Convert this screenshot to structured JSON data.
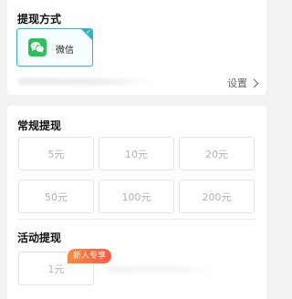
{
  "withdraw_method": {
    "title": "提现方式",
    "option_label": "微信",
    "option_icon": "wechat-icon",
    "settings_label": "设置"
  },
  "regular_withdraw": {
    "title": "常规提现",
    "amounts": [
      "5元",
      "10元",
      "20元",
      "50元",
      "100元",
      "200元"
    ]
  },
  "activity_withdraw": {
    "title": "活动提现",
    "amount": "1元",
    "badge": "新人专享"
  },
  "colors": {
    "accent": "#29b6c6",
    "wechat_green": "#2dc15b",
    "badge_orange": "#ff6a40"
  }
}
